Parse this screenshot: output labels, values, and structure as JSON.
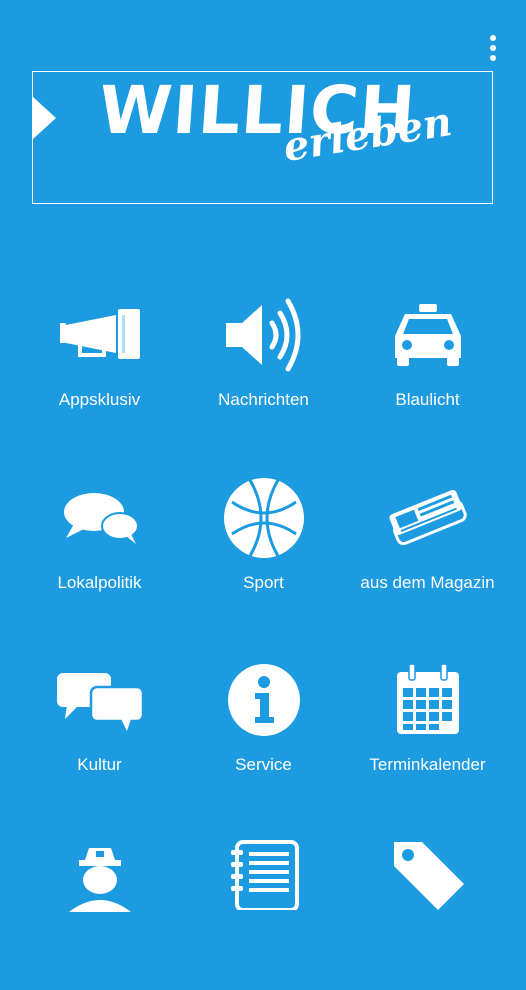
{
  "header": {
    "logo_title": "WILLICH",
    "logo_subtitle": "erleben"
  },
  "menu_overflow_icon": "more-vertical-icon",
  "grid": [
    {
      "label": "Appsklusiv",
      "icon": "megaphone-icon"
    },
    {
      "label": "Nachrichten",
      "icon": "speaker-icon"
    },
    {
      "label": "Blaulicht",
      "icon": "taxi-icon"
    },
    {
      "label": "Lokalpolitik",
      "icon": "chat-bubbles-icon"
    },
    {
      "label": "Sport",
      "icon": "basketball-icon"
    },
    {
      "label": "aus dem Magazin",
      "icon": "newspaper-icon"
    },
    {
      "label": "Kultur",
      "icon": "speech-bubbles-icon"
    },
    {
      "label": "Service",
      "icon": "info-icon"
    },
    {
      "label": "Terminkalender",
      "icon": "calendar-icon"
    },
    {
      "label": "",
      "icon": "person-hat-icon"
    },
    {
      "label": "",
      "icon": "notepad-icon"
    },
    {
      "label": "",
      "icon": "tag-icon"
    }
  ],
  "colors": {
    "background": "#1c9be0",
    "foreground": "#ffffff"
  }
}
